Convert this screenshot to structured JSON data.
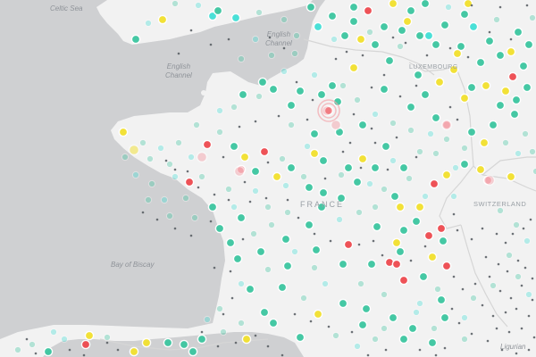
{
  "map": {
    "sea_labels": {
      "celtic_sea": "Celtic Sea",
      "english_channel_1": "English\nChannel",
      "english_channel_2": "English\nChannel",
      "bay_of_biscay": "Bay of Biscay",
      "ligurian": "Ligurian"
    },
    "country_labels": {
      "france": "FRANCE",
      "switzerland": "SWITZERLAND",
      "luxembourg": "LUXEMBOURG"
    },
    "colors": {
      "sea": "#cfd0d2",
      "land": "#f2f2f2",
      "border": "#d6d6d6",
      "green": "#3cc6a0",
      "teal": "#40e0d6",
      "yellow": "#f2e12e",
      "red": "#ee4a4f",
      "pink": "#f4a6ad",
      "grey_dot": "#555b60"
    }
  }
}
